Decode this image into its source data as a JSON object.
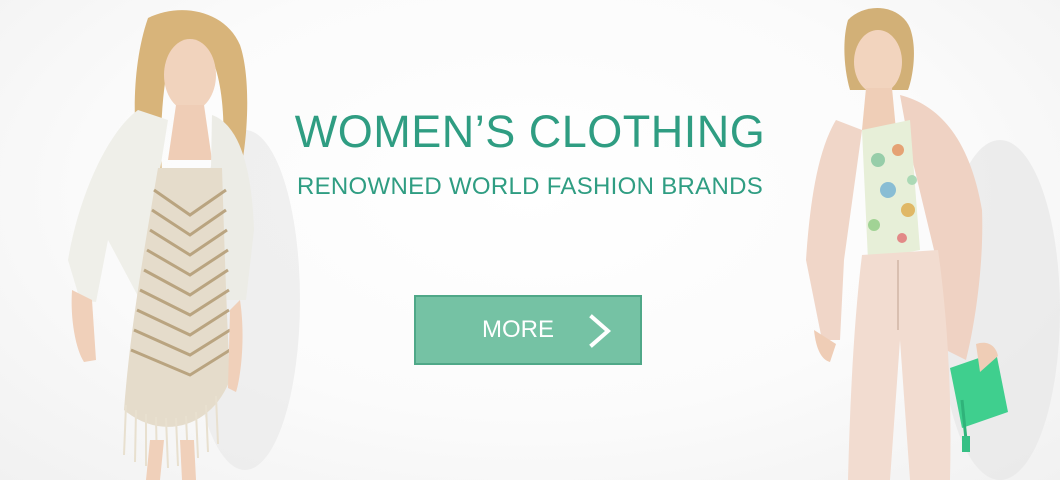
{
  "banner": {
    "headline": "WOMEN’S CLOTHING",
    "subheadline": "RENOWNED WORLD FASHION BRANDS",
    "cta_label": "MORE",
    "cta_icon": "chevron-right-icon"
  },
  "colors": {
    "accent_text": "#2f9d82",
    "button_fill": "#75c2a4",
    "button_border": "#4fa888",
    "button_text": "#ffffff",
    "background": "#ffffff"
  }
}
